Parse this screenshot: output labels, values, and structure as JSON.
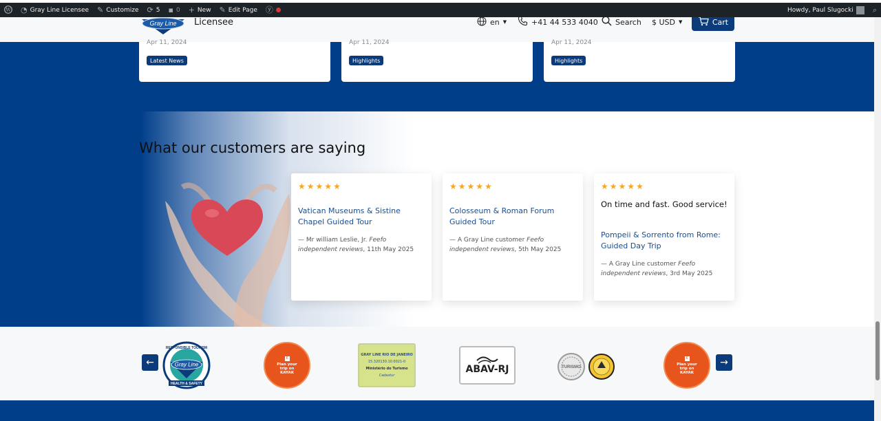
{
  "adminbar": {
    "site_name": "Gray Line Licensee",
    "customize": "Customize",
    "updates": "5",
    "comments": "0",
    "new": "New",
    "edit_page": "Edit Page",
    "howdy": "Howdy, Paul Slugocki"
  },
  "header": {
    "logo_text": "Gray Line",
    "title": "Licensee",
    "language": "en",
    "phone": "+41 44 533 4040",
    "search": "Search",
    "currency": "$ USD",
    "cart": "Cart"
  },
  "news": [
    {
      "date": "Apr 11, 2024",
      "tag": "Latest News"
    },
    {
      "date": "Apr 11, 2024",
      "tag": "Highlights"
    },
    {
      "date": "Apr 11, 2024",
      "tag": "Highlights"
    }
  ],
  "testimonials": {
    "title": "What our customers are saying",
    "reviews": [
      {
        "stars": 5,
        "quote": "",
        "tour": "Vatican Museums & Sistine Chapel Guided Tour",
        "author": "Mr william Leslie, Jr.",
        "source": "Feefo independent reviews",
        "date": "11th May 2025"
      },
      {
        "stars": 5,
        "quote": "",
        "tour": "Colosseum & Roman Forum Guided Tour",
        "author": "A Gray Line customer",
        "source": "Feefo independent reviews",
        "date": "5th May 2025"
      },
      {
        "stars": 5,
        "quote": "On time and fast. Good service!",
        "tour": "Pompeii & Sorrento from Rome: Guided Day Trip",
        "author": "A Gray Line customer",
        "source": "Feefo independent reviews",
        "date": "3rd May 2025"
      }
    ]
  },
  "partners": {
    "logos": [
      {
        "name": "Gray Line Responsible Tourism Health & Safety",
        "text_top": "RESPONSIBLE TOURISM",
        "text_mid": "Gray Line",
        "text_bottom": "HEALTH & SAFETY"
      },
      {
        "name": "Plan your trip on KAYAK",
        "text": "Plan your trip on KAYAK"
      },
      {
        "name": "Gray Line Rio de Janeiro - Ministério do Turismo",
        "text_top": "GRAY LINE RIO DE JANEIRO",
        "text_id": "15.320130.10.0021-0",
        "text_bottom": "Ministério do Turismo",
        "text_brand": "Cadastur"
      },
      {
        "name": "ABAV-RJ",
        "text": "ABAV-RJ"
      },
      {
        "name": "Turismo Responsável",
        "text": "TURISMO"
      },
      {
        "name": "Plan your trip on KAYAK",
        "text": "Plan your trip on KAYAK"
      }
    ],
    "prev_icon": "arrow-left-icon",
    "next_icon": "arrow-right-icon"
  },
  "colors": {
    "brand_blue": "#003e8a",
    "button_blue": "#0b3b7a",
    "star": "#f5a623",
    "link": "#1a4e8f",
    "kayak_orange": "#e8551c"
  }
}
